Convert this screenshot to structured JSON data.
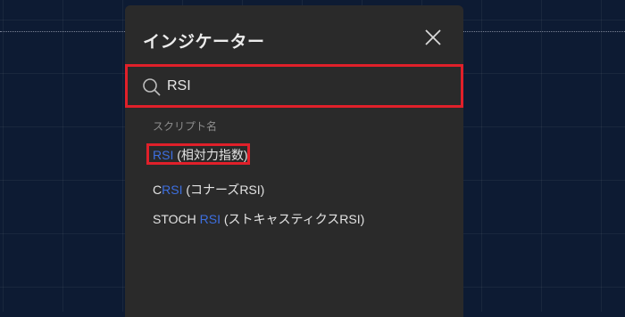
{
  "dialog": {
    "title": "インジケーター"
  },
  "search": {
    "value": "RSI",
    "placeholder": ""
  },
  "section": {
    "label": "スクリプト名"
  },
  "results": [
    {
      "pre": "",
      "match": "RSI",
      "post": " (相対力指数)"
    },
    {
      "pre": "C",
      "match": "RSI",
      "post": " (コナーズRSI)"
    },
    {
      "pre": "STOCH ",
      "match": "RSI",
      "post": " (ストキャスティクスRSI)"
    }
  ],
  "colors": {
    "background": "#0d1b33",
    "dialog": "#2a2a2a",
    "highlight_border": "#e0202a",
    "match_text": "#3d6fe0"
  },
  "icons": {
    "search": "search-icon",
    "close": "close-icon"
  }
}
